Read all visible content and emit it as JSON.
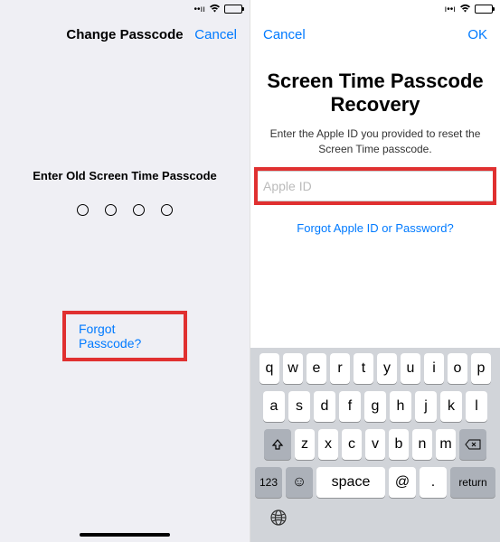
{
  "left": {
    "nav_title": "Change Passcode",
    "cancel": "Cancel",
    "prompt": "Enter Old Screen Time Passcode",
    "forgot": "Forgot Passcode?"
  },
  "right": {
    "cancel": "Cancel",
    "ok": "OK",
    "title": "Screen Time Passcode Recovery",
    "subtitle": "Enter the Apple ID you provided to reset the Screen Time passcode.",
    "placeholder": "Apple ID",
    "forgot_apple": "Forgot Apple ID or Password?"
  },
  "keyboard": {
    "row1": [
      "q",
      "w",
      "e",
      "r",
      "t",
      "y",
      "u",
      "i",
      "o",
      "p"
    ],
    "row2": [
      "a",
      "s",
      "d",
      "f",
      "g",
      "h",
      "j",
      "k",
      "l"
    ],
    "row3": [
      "z",
      "x",
      "c",
      "v",
      "b",
      "n",
      "m"
    ],
    "k123": "123",
    "space": "space",
    "at": "@",
    "dot": ".",
    "ret": "return"
  }
}
